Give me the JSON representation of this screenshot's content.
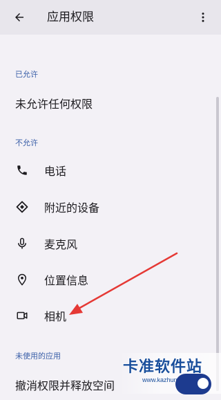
{
  "appbar": {
    "title": "应用权限"
  },
  "sections": {
    "allowed": {
      "header": "已允许",
      "items": [
        {
          "label": "未允许任何权限"
        }
      ]
    },
    "denied": {
      "header": "不允许",
      "items": [
        {
          "label": "电话",
          "icon": "phone-icon"
        },
        {
          "label": "附近的设备",
          "icon": "nearby-devices-icon"
        },
        {
          "label": "麦克风",
          "icon": "microphone-icon"
        },
        {
          "label": "位置信息",
          "icon": "location-icon"
        },
        {
          "label": "相机",
          "icon": "camera-icon"
        }
      ]
    },
    "unused": {
      "header": "未使用的应用",
      "items": [
        {
          "label": "撤消权限并释放空间"
        }
      ]
    }
  },
  "watermark": {
    "text": "卡准软件站",
    "url": "www.kazhun.com"
  },
  "colors": {
    "section_header": "#3a5fa8",
    "annotation_arrow": "#e53935",
    "appbar_bg": "#e8e6ec",
    "page_bg": "#f3f1f6"
  }
}
